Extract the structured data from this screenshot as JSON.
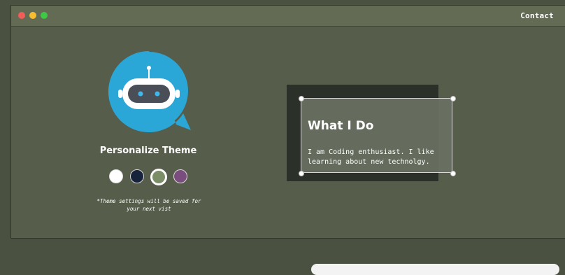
{
  "window": {
    "controls": [
      "close",
      "minimize",
      "maximize"
    ],
    "nav": {
      "contact_label": "Contact"
    }
  },
  "sidebar": {
    "logo_icon": "robot-chat-bubble-icon",
    "theme_title": "Personalize Theme",
    "swatches": [
      {
        "name": "white",
        "color": "#ffffff",
        "selected": false
      },
      {
        "name": "navy",
        "color": "#17223b",
        "selected": false
      },
      {
        "name": "green",
        "color": "#7b8e68",
        "selected": true
      },
      {
        "name": "purple",
        "color": "#7a4d7e",
        "selected": false
      }
    ],
    "note_line1": "*Theme settings will be saved for",
    "note_line2": "your next vist"
  },
  "card": {
    "title": "What I Do",
    "body_line1": "I am Coding enthusiast. I like",
    "body_line2": "learning about new technolgy."
  },
  "colors": {
    "window_bg": "#565d4a",
    "card_back": "#2b3128",
    "accent_blue": "#2aa7d6"
  }
}
